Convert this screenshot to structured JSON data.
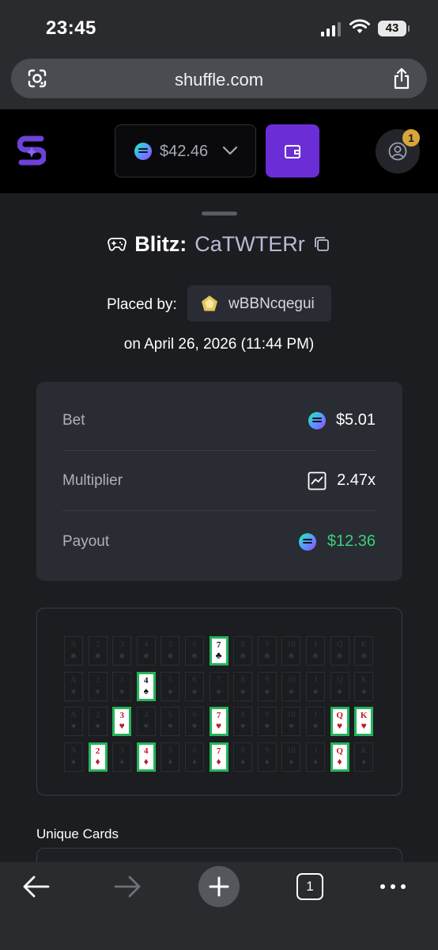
{
  "status": {
    "time": "23:45",
    "battery": "43"
  },
  "browser": {
    "url": "shuffle.com"
  },
  "header": {
    "balance": "$42.46",
    "notifications": "1"
  },
  "bet": {
    "game": "Blitz:",
    "id": "CaTWTERr",
    "placed_by_label": "Placed by:",
    "user": "wBBNcqegui",
    "date": "on April 26, 2026 (11:44 PM)"
  },
  "stats": {
    "bet_label": "Bet",
    "bet_value": "$5.01",
    "multiplier_label": "Multiplier",
    "multiplier_value": "2.47x",
    "payout_label": "Payout",
    "payout_value": "$12.36",
    "payout_color": "#38d27a"
  },
  "cards": {
    "ranks": [
      "A",
      "2",
      "3",
      "4",
      "5",
      "6",
      "7",
      "8",
      "9",
      "10",
      "J",
      "Q",
      "K"
    ],
    "suits": [
      "♣",
      "♠",
      "♥",
      "♦"
    ],
    "selected": [
      {
        "rank": "7",
        "suit": "♣"
      },
      {
        "rank": "4",
        "suit": "♠"
      },
      {
        "rank": "3",
        "suit": "♥"
      },
      {
        "rank": "7",
        "suit": "♥"
      },
      {
        "rank": "Q",
        "suit": "♥"
      },
      {
        "rank": "K",
        "suit": "♥"
      },
      {
        "rank": "2",
        "suit": "♦"
      },
      {
        "rank": "4",
        "suit": "♦"
      },
      {
        "rank": "7",
        "suit": "♦"
      },
      {
        "rank": "Q",
        "suit": "♦"
      }
    ]
  },
  "unique_cards_label": "Unique Cards",
  "nav": {
    "tabs_count": "1"
  },
  "colors": {
    "accent": "#6b2dd6",
    "highlight_border": "#25b35a"
  },
  "icons": [
    "google-lens-icon",
    "share-icon",
    "shuffle-logo-icon",
    "solana-coin-icon",
    "chevron-down-icon",
    "wallet-icon",
    "user-icon",
    "gamepad-icon",
    "copy-icon",
    "gem-avatar-icon",
    "chart-icon",
    "back-arrow-icon",
    "forward-arrow-icon",
    "plus-icon",
    "more-icon"
  ]
}
